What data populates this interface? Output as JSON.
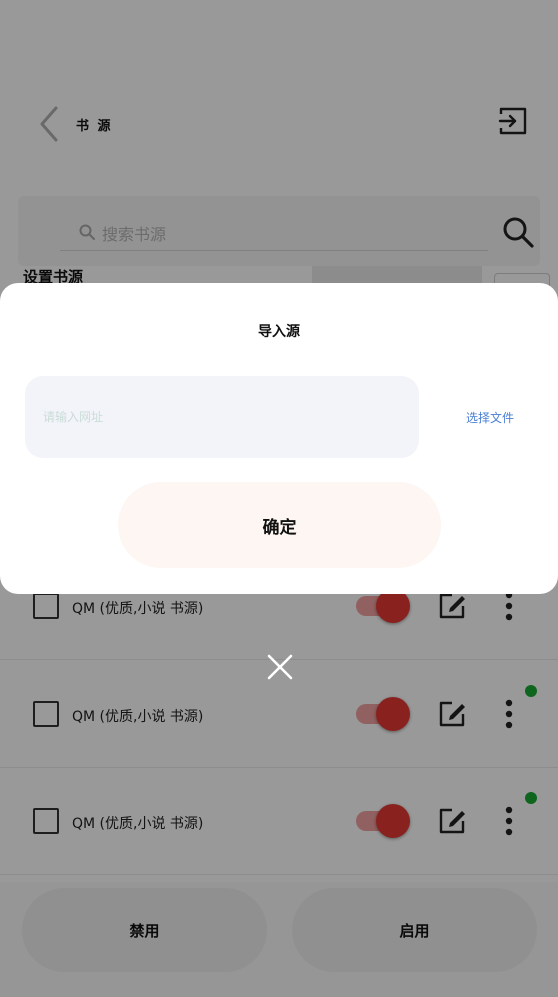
{
  "header": {
    "title": "书 源",
    "back_icon": "chevron-left-icon",
    "import_icon": "import-icon"
  },
  "search": {
    "placeholder": "搜索书源",
    "icon": "search-icon"
  },
  "section": {
    "label": "设置书源"
  },
  "sources": [
    {
      "name": "QM (优质,小说 书源)",
      "enabled": true,
      "has_update_dot": false
    },
    {
      "name": "QM (优质,小说 书源)",
      "enabled": true,
      "has_update_dot": true
    },
    {
      "name": "QM (优质,小说 书源)",
      "enabled": true,
      "has_update_dot": true
    }
  ],
  "bottom": {
    "disable_label": "禁用",
    "enable_label": "启用"
  },
  "dialog": {
    "title": "导入源",
    "url_placeholder": "请输入网址",
    "url_value": "",
    "choose_file_label": "选择文件",
    "confirm_label": "确定"
  },
  "colors": {
    "accent_red": "#e53935",
    "toggle_track": "#f2a0a0",
    "link_blue": "#4a7fd4",
    "status_dot": "#16a832",
    "input_bg": "#f3f3fa",
    "confirm_bg": "#fdf6f2"
  }
}
